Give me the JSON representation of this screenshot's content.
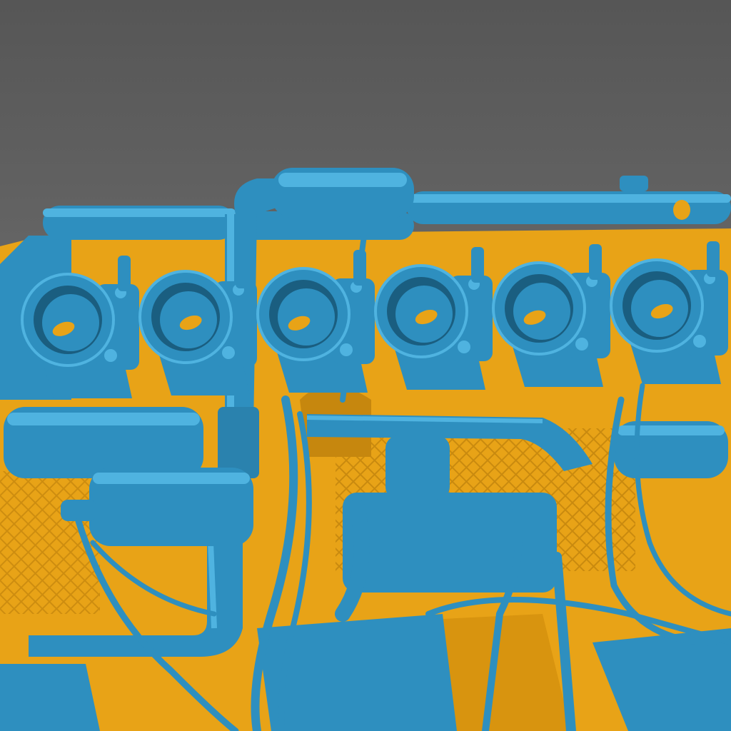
{
  "viewport": {
    "background_top": "#565656",
    "background_bottom": "#808080"
  },
  "scene": {
    "subject": "engine scan",
    "colors": {
      "reference_mesh": "#E8A317",
      "scan_mesh": "#2E8FBF",
      "scan_highlight": "#4FB3E0",
      "scan_shadow": "#1A5E80",
      "reference_shadow": "#B87A0A"
    },
    "throttle_body_count": 6
  }
}
